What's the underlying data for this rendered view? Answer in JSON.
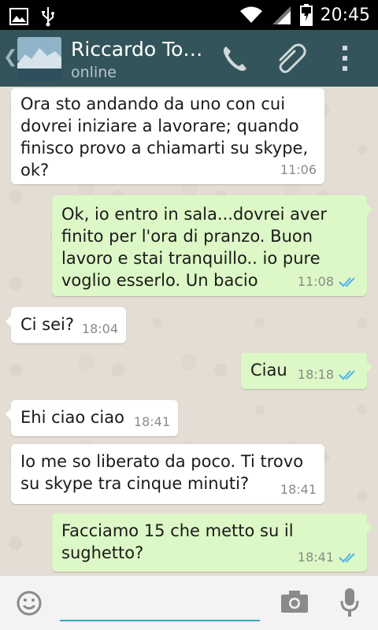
{
  "status_bar": {
    "time": "20:45",
    "icons": [
      "image-icon",
      "usb-icon",
      "wifi-icon",
      "signal-icon",
      "battery-charging-icon"
    ]
  },
  "header": {
    "contact_name": "Riccardo To…",
    "status": "online",
    "actions": [
      "phone-icon",
      "attach-icon",
      "overflow-menu-icon"
    ]
  },
  "messages": [
    {
      "direction": "in",
      "text": "Ora sto andando da uno con cui\ndovrei iniziare a lavorare; quando\nfinisco provo a chiamarti su skype,\nok?",
      "time": "11:06"
    },
    {
      "direction": "out",
      "text": "Ok, io entro in sala...dovrei aver\nfinito per l'ora di pranzo. Buon\nlavoro e stai tranquillo.. io pure\nvoglio esserlo. Un bacio",
      "time": "11:08",
      "read": true
    },
    {
      "direction": "in",
      "text": "Ci sei?",
      "time": "18:04"
    },
    {
      "direction": "out",
      "text": "Ciau",
      "time": "18:18",
      "read": true
    },
    {
      "direction": "in",
      "text": "Ehi ciao ciao",
      "time": "18:41"
    },
    {
      "direction": "in",
      "text": "Io me so liberato da poco. Ti trovo\nsu skype tra cinque minuti?",
      "time": "18:41"
    },
    {
      "direction": "out",
      "text": "Facciamo 15 che metto su il\nsughetto?",
      "time": "18:41",
      "read": true
    }
  ],
  "input_bar": {
    "placeholder": "",
    "value": ""
  },
  "colors": {
    "header": "#33545a",
    "outgoing_bubble": "#dcf8c6",
    "incoming_bubble": "#ffffff",
    "read_ticks": "#4fb3e8",
    "input_accent": "#3aa7b5"
  }
}
